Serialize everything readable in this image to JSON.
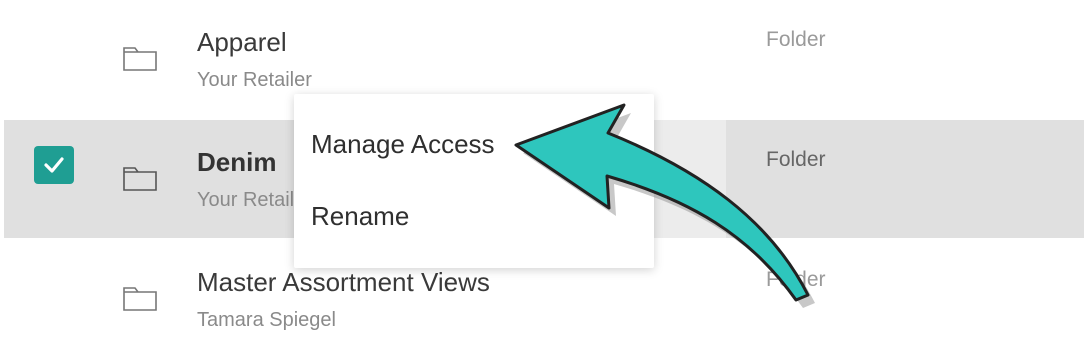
{
  "rows": [
    {
      "name": "Apparel",
      "owner": "Your Retailer",
      "type": "Folder",
      "selected": false
    },
    {
      "name": "Denim",
      "owner": "Your Retailer",
      "type": "Folder",
      "selected": true
    },
    {
      "name": "Master Assortment Views",
      "owner": "Tamara Spiegel",
      "type": "Folder",
      "selected": false
    }
  ],
  "context_menu": {
    "items": [
      {
        "label": "Manage Access"
      },
      {
        "label": "Rename"
      }
    ]
  },
  "colors": {
    "accent": "#1f9e93",
    "arrow_fill": "#2ec6bd",
    "selected_row": "#e0e0e0"
  },
  "icons": {
    "row_icon": "folder-icon",
    "check": "checkmark-icon",
    "callout": "curved-arrow-icon"
  }
}
